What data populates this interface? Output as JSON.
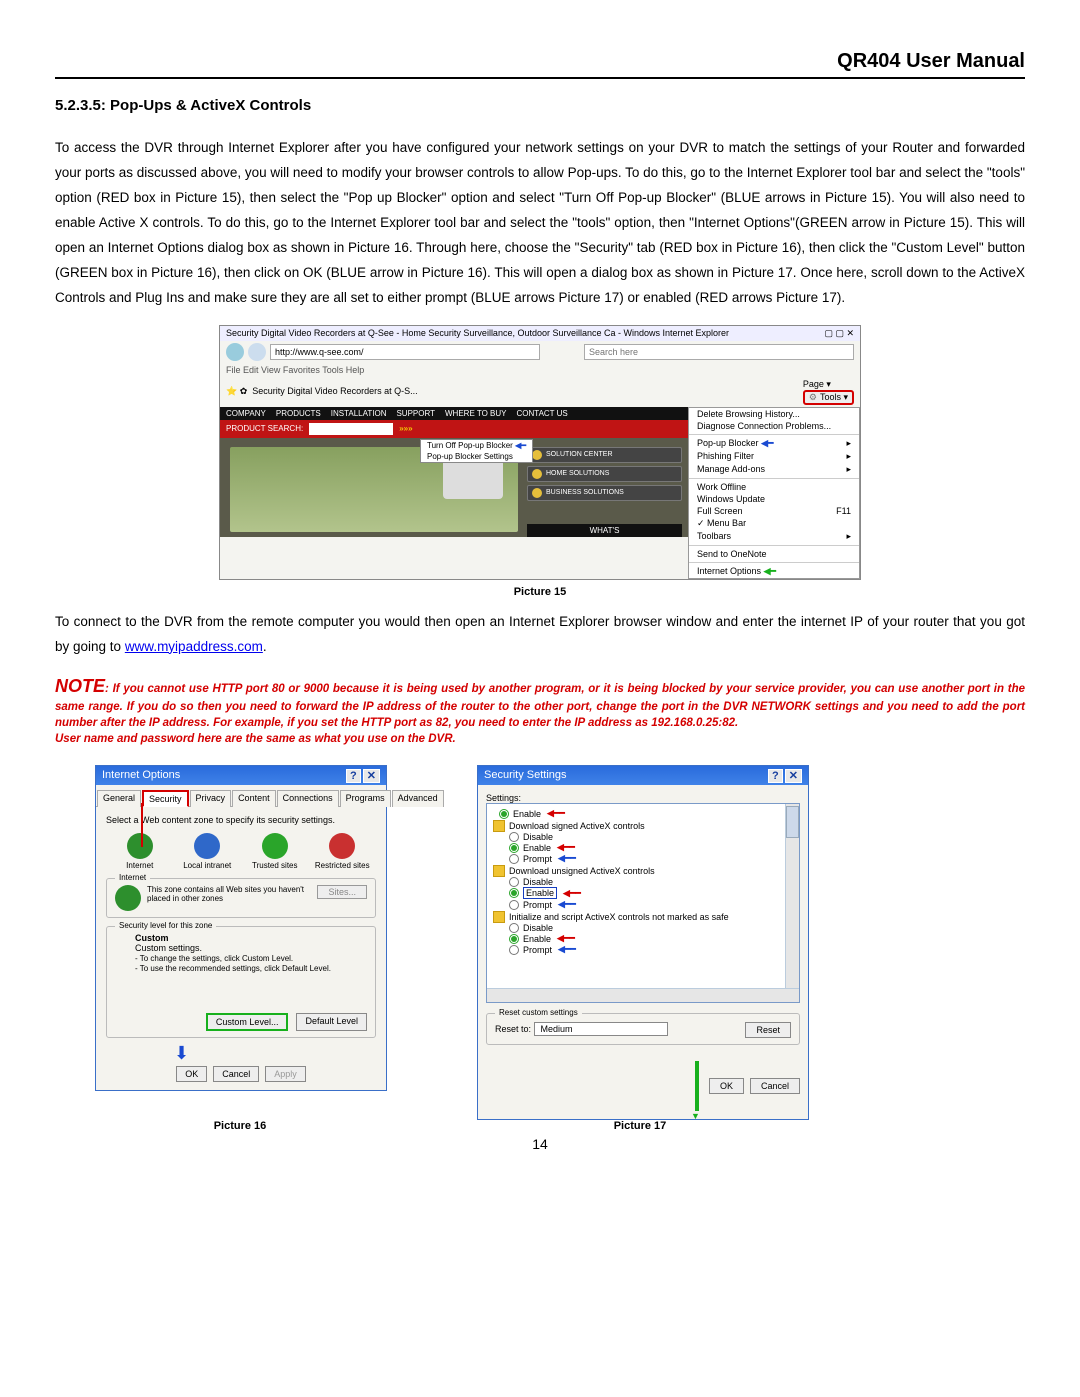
{
  "doc_title": "QR404 User Manual",
  "section": "5.2.3.5: Pop-Ups & ActiveX Controls",
  "para1": "To access the DVR through Internet Explorer after you have configured your network settings on your DVR to match the settings of your Router and forwarded your ports as discussed above, you will need to modify your browser controls to allow Pop-ups.   To do this, go to the Internet Explorer tool bar and select the \"tools\" option (RED box in Picture 15), then select the \"Pop up Blocker\" option and select \"Turn Off Pop-up Blocker\" (BLUE arrows in Picture 15). You will also need to enable Active X controls. To do this, go to the Internet Explorer tool bar and select the \"tools\" option, then \"Internet Options\"(GREEN arrow in Picture 15).   This will open an Internet Options dialog box as shown in Picture 16.   Through here, choose the \"Security\" tab (RED box in Picture 16), then click the \"Custom Level\" button (GREEN box in Picture 16), then click on OK (BLUE arrow in Picture 16).   This will open a dialog box as shown in Picture 17.   Once here, scroll down to the ActiveX Controls and Plug Ins and make sure they are all set to either prompt (BLUE arrows Picture 17) or enabled (RED arrows Picture 17).",
  "para2_a": "To connect to the DVR from the remote computer you would then open an Internet Explorer browser window and enter the internet IP of your router that you got by going to ",
  "para2_link": "www.myipaddress.com",
  "para2_b": ".",
  "note_lead": "NOTE",
  "note_body": ": If you cannot use HTTP port 80 or 9000 because it is being used by another program, or it is being blocked by your service provider, you can use another port in the same range. If you do so then you need to forward the IP address of the router to the other port, change the port in the DVR NETWORK settings and you need to add the port number after the IP address. For example, if you set the HTTP port as 82, you need to enter the IP address as 192.168.0.25:82.",
  "note_line2": "User name and password here are the same as what you use on the DVR.",
  "cap15": "Picture 15",
  "cap16": "Picture 16",
  "cap17": "Picture 17",
  "page_num": "14",
  "pic15": {
    "wintitle": "Security Digital Video Recorders at Q-See - Home Security Surveillance, Outdoor Surveillance Ca - Windows Internet Explorer",
    "url": "http://www.q-see.com/",
    "search_ph": "Search here",
    "menus": "File   Edit   View   Favorites   Tools   Help",
    "tab": "Security Digital Video Recorders at Q-S...",
    "page_btn": "Page ▾",
    "tools_btn": "Tools ▾",
    "dd": {
      "d1": "Delete Browsing History...",
      "d2": "Diagnose Connection Problems...",
      "d3": "Pop-up Blocker",
      "d4": "Phishing Filter",
      "d5": "Manage Add-ons",
      "d6": "Work Offline",
      "d7": "Windows Update",
      "d8": "Full Screen",
      "d8k": "F11",
      "d9": "Menu Bar",
      "d10": "Toolbars",
      "d11": "Send to OneNote",
      "d12": "Internet Options"
    },
    "pop1": "Turn Off Pop-up Blocker",
    "pop2": "Pop-up Blocker Settings",
    "nav": {
      "n1": "COMPANY",
      "n2": "PRODUCTS",
      "n3": "INSTALLATION",
      "n4": "SUPPORT",
      "n5": "WHERE TO BUY",
      "n6": "CONTACT US"
    },
    "psearch": "PRODUCT SEARCH:",
    "col": {
      "c1": "SOLUTION CENTER",
      "c2": "HOME SOLUTIONS",
      "c3": "BUSINESS SOLUTIONS"
    },
    "whats": "WHAT'S"
  },
  "pic16": {
    "title": "Internet Options",
    "tabs": {
      "t1": "General",
      "t2": "Security",
      "t3": "Privacy",
      "t4": "Content",
      "t5": "Connections",
      "t6": "Programs",
      "t7": "Advanced"
    },
    "hint": "Select a Web content zone to specify its security settings.",
    "z": {
      "z1": "Internet",
      "z2": "Local intranet",
      "z3": "Trusted sites",
      "z4": "Restricted sites"
    },
    "fs_int": "Internet",
    "fs_txt": "This zone contains all Web sites you haven't placed in other zones",
    "sites": "Sites...",
    "sec_leg": "Security level for this zone",
    "custom": "Custom",
    "cs": "Custom settings.",
    "cs1": "- To change the settings, click Custom Level.",
    "cs2": "- To use the recommended settings, click Default Level.",
    "b_custom": "Custom Level...",
    "b_default": "Default Level",
    "b_ok": "OK",
    "b_cancel": "Cancel",
    "b_apply": "Apply"
  },
  "pic17": {
    "title": "Security Settings",
    "settings": "Settings:",
    "g0_enable": "Enable",
    "g1": "Download signed ActiveX controls",
    "g2": "Download unsigned ActiveX controls",
    "g3": "Initialize and script ActiveX controls not marked as safe",
    "disable": "Disable",
    "enable": "Enable",
    "prompt": "Prompt",
    "reset_leg": "Reset custom settings",
    "reset_to": "Reset to:",
    "medium": "Medium",
    "b_reset": "Reset",
    "b_ok": "OK",
    "b_cancel": "Cancel"
  }
}
